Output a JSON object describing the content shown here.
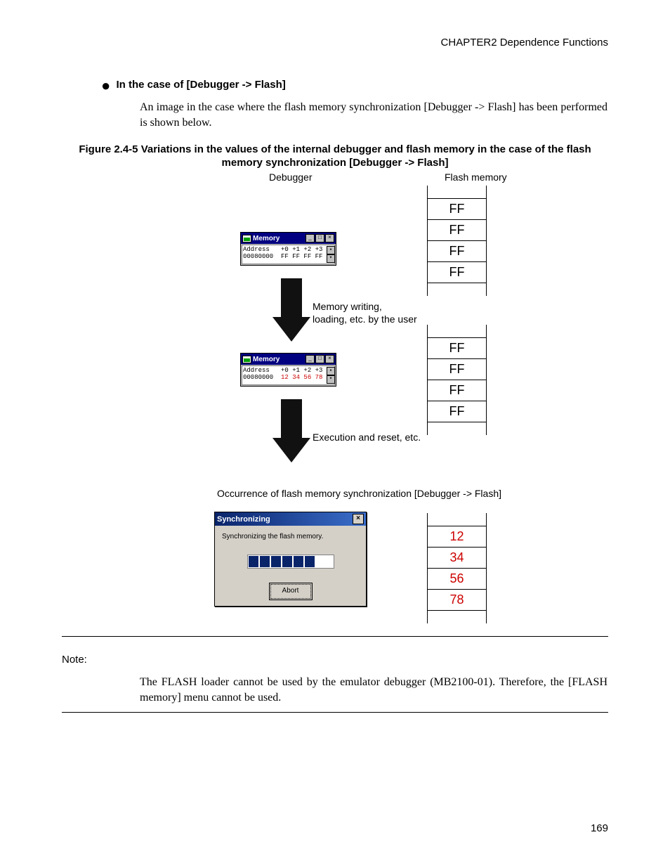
{
  "header": {
    "chapter": "CHAPTER2  Dependence Functions"
  },
  "section": {
    "bullet_title": "In the case of [Debugger -> Flash]"
  },
  "intro": "An image in the case where the flash memory synchronization [Debugger -> Flash] has been performed is shown below.",
  "figure": {
    "caption": "Figure 2.4-5  Variations in the values of the internal debugger and flash memory in the case of the flash memory synchronization [Debugger -> Flash]",
    "debugger_col": "Debugger",
    "flash_col": "Flash memory",
    "action1": "Memory writing,\nloading, etc. by the user",
    "action2": "Execution and reset, etc.",
    "occurrence": "Occurrence of flash memory synchronization [Debugger -> Flash]"
  },
  "mem_window": {
    "title": "Memory",
    "header_row": "Address   +0 +1 +2 +3",
    "row1_addr": "00080000",
    "row1_vals_ff": "FF FF FF FF",
    "row1_vals_new": "12 34 56 78"
  },
  "flash_tables": {
    "t1": [
      "FF",
      "FF",
      "FF",
      "FF"
    ],
    "t2": [
      "FF",
      "FF",
      "FF",
      "FF"
    ],
    "t3": [
      "12",
      "34",
      "56",
      "78"
    ]
  },
  "sync_dialog": {
    "title": "Synchronizing",
    "message": "Synchronizing the flash memory.",
    "abort": "Abort"
  },
  "note": {
    "label": "Note:",
    "text": "The FLASH loader cannot be used by the emulator debugger (MB2100-01). Therefore, the [FLASH memory] menu cannot be used."
  },
  "page_number": "169"
}
